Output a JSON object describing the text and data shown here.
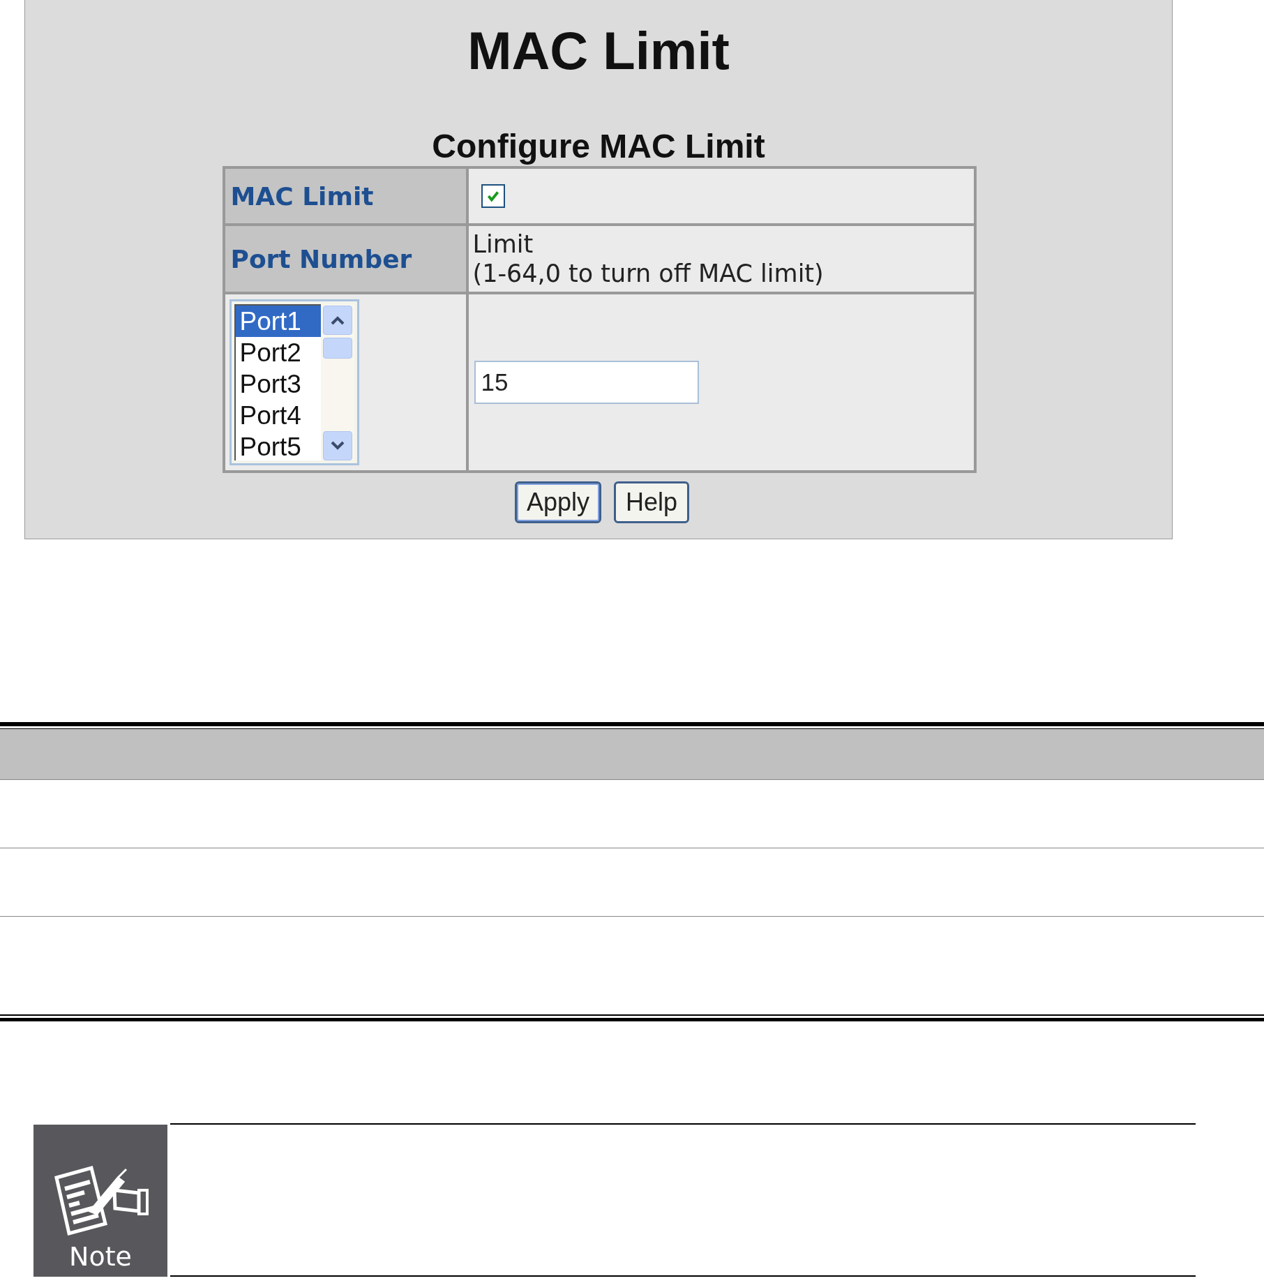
{
  "panel": {
    "title": "MAC Limit",
    "subtitle": "Configure MAC Limit",
    "mac_limit": {
      "label": "MAC Limit",
      "checked": true
    },
    "port_number": {
      "label": "Port Number",
      "limit_heading": [
        "Limit",
        "(1-64,0 to turn off MAC limit)"
      ]
    },
    "ports": [
      {
        "label": "Port1",
        "selected": true
      },
      {
        "label": "Port2",
        "selected": false
      },
      {
        "label": "Port3",
        "selected": false
      },
      {
        "label": "Port4",
        "selected": false
      },
      {
        "label": "Port5",
        "selected": false
      }
    ],
    "limit_value": "15",
    "buttons": [
      {
        "label": "Apply",
        "focused": true
      },
      {
        "label": "Help",
        "focused": false
      }
    ]
  },
  "note": {
    "label": "Note"
  }
}
